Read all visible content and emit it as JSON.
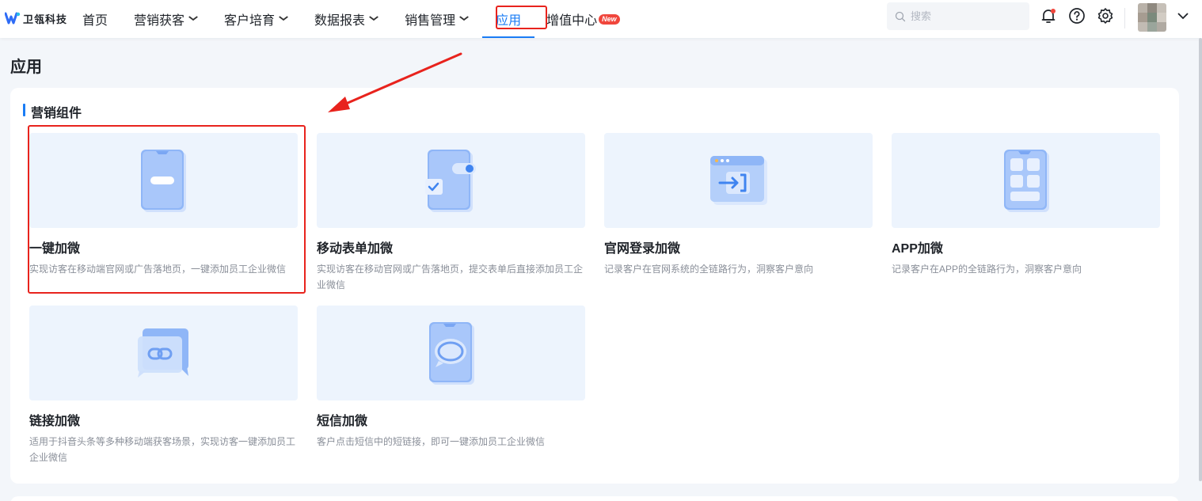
{
  "brand": {
    "name": "卫瓴科技"
  },
  "nav": {
    "items": [
      {
        "label": "首页",
        "dropdown": false
      },
      {
        "label": "营销获客",
        "dropdown": true
      },
      {
        "label": "客户培育",
        "dropdown": true
      },
      {
        "label": "数据报表",
        "dropdown": true
      },
      {
        "label": "销售管理",
        "dropdown": true
      },
      {
        "label": "应用",
        "dropdown": false,
        "active": true
      },
      {
        "label": "增值中心",
        "dropdown": false,
        "badge": "New"
      }
    ],
    "chevron": "⌄"
  },
  "header": {
    "search_placeholder": "搜索",
    "icons": [
      "search-icon",
      "bell-icon",
      "help-icon",
      "gear-icon",
      "chevron-down-icon"
    ]
  },
  "page": {
    "title": "应用"
  },
  "section": {
    "title": "营销组件"
  },
  "cards": [
    {
      "name": "一键加微",
      "desc": "实现访客在移动端官网或广告落地页，一键添加员工企业微信",
      "icon": "phone-button-icon"
    },
    {
      "name": "移动表单加微",
      "desc": "实现访客在移动官网或广告落地页，提交表单后直接添加员工企业微信",
      "icon": "phone-form-icon"
    },
    {
      "name": "官网登录加微",
      "desc": "记录客户在官网系统的全链路行为，洞察客户意向",
      "icon": "browser-login-icon"
    },
    {
      "name": "APP加微",
      "desc": "记录客户在APP的全链路行为，洞察客户意向",
      "icon": "app-grid-icon"
    },
    {
      "name": "链接加微",
      "desc": "适用于抖音头条等多种移动端获客场景，实现访客一键添加员工企业微信",
      "icon": "link-chat-icon"
    },
    {
      "name": "短信加微",
      "desc": "客户点击短信中的短链接，即可一键添加员工企业微信",
      "icon": "sms-icon"
    }
  ],
  "colors": {
    "accent": "#1a7cf5",
    "annotation": "#e8231d",
    "thumb_bg": "#edf4fd",
    "badge": "#f0463c"
  }
}
